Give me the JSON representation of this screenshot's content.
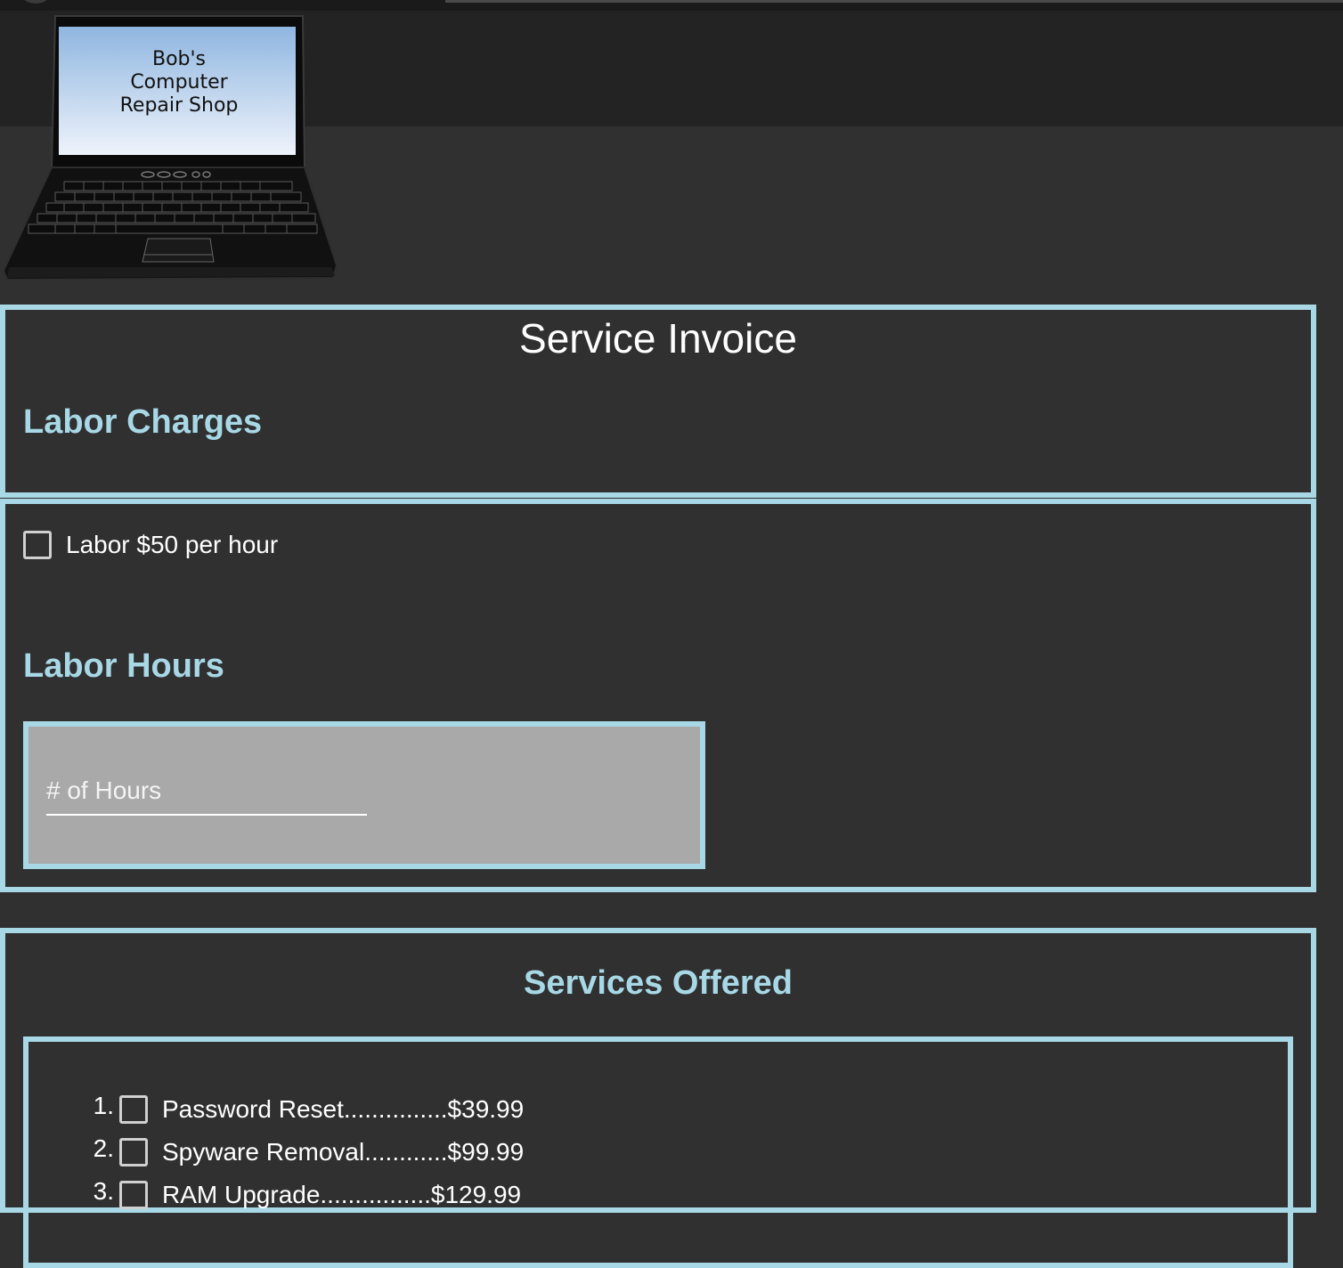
{
  "header": {
    "logo_lines": [
      "Bob's",
      "Computer",
      "Repair Shop"
    ]
  },
  "invoice": {
    "title": "Service Invoice",
    "labor_charges_heading": "Labor Charges"
  },
  "labor": {
    "checkbox_label": "Labor $50 per hour",
    "checked": false,
    "hours_heading": "Labor Hours",
    "hours_input": {
      "placeholder": "# of Hours",
      "value": ""
    }
  },
  "services": {
    "heading": "Services Offered",
    "items": [
      {
        "number": "1.",
        "label": "Password Reset...............$39.99",
        "checked": false
      },
      {
        "number": "2.",
        "label": "Spyware Removal............$99.99",
        "checked": false
      },
      {
        "number": "3.",
        "label": "RAM Upgrade................$129.99",
        "checked": false
      }
    ]
  },
  "colors": {
    "accent": "#a8d8e6",
    "background": "#303030",
    "topbar": "#232323",
    "input_box": "#a9a9a9"
  }
}
